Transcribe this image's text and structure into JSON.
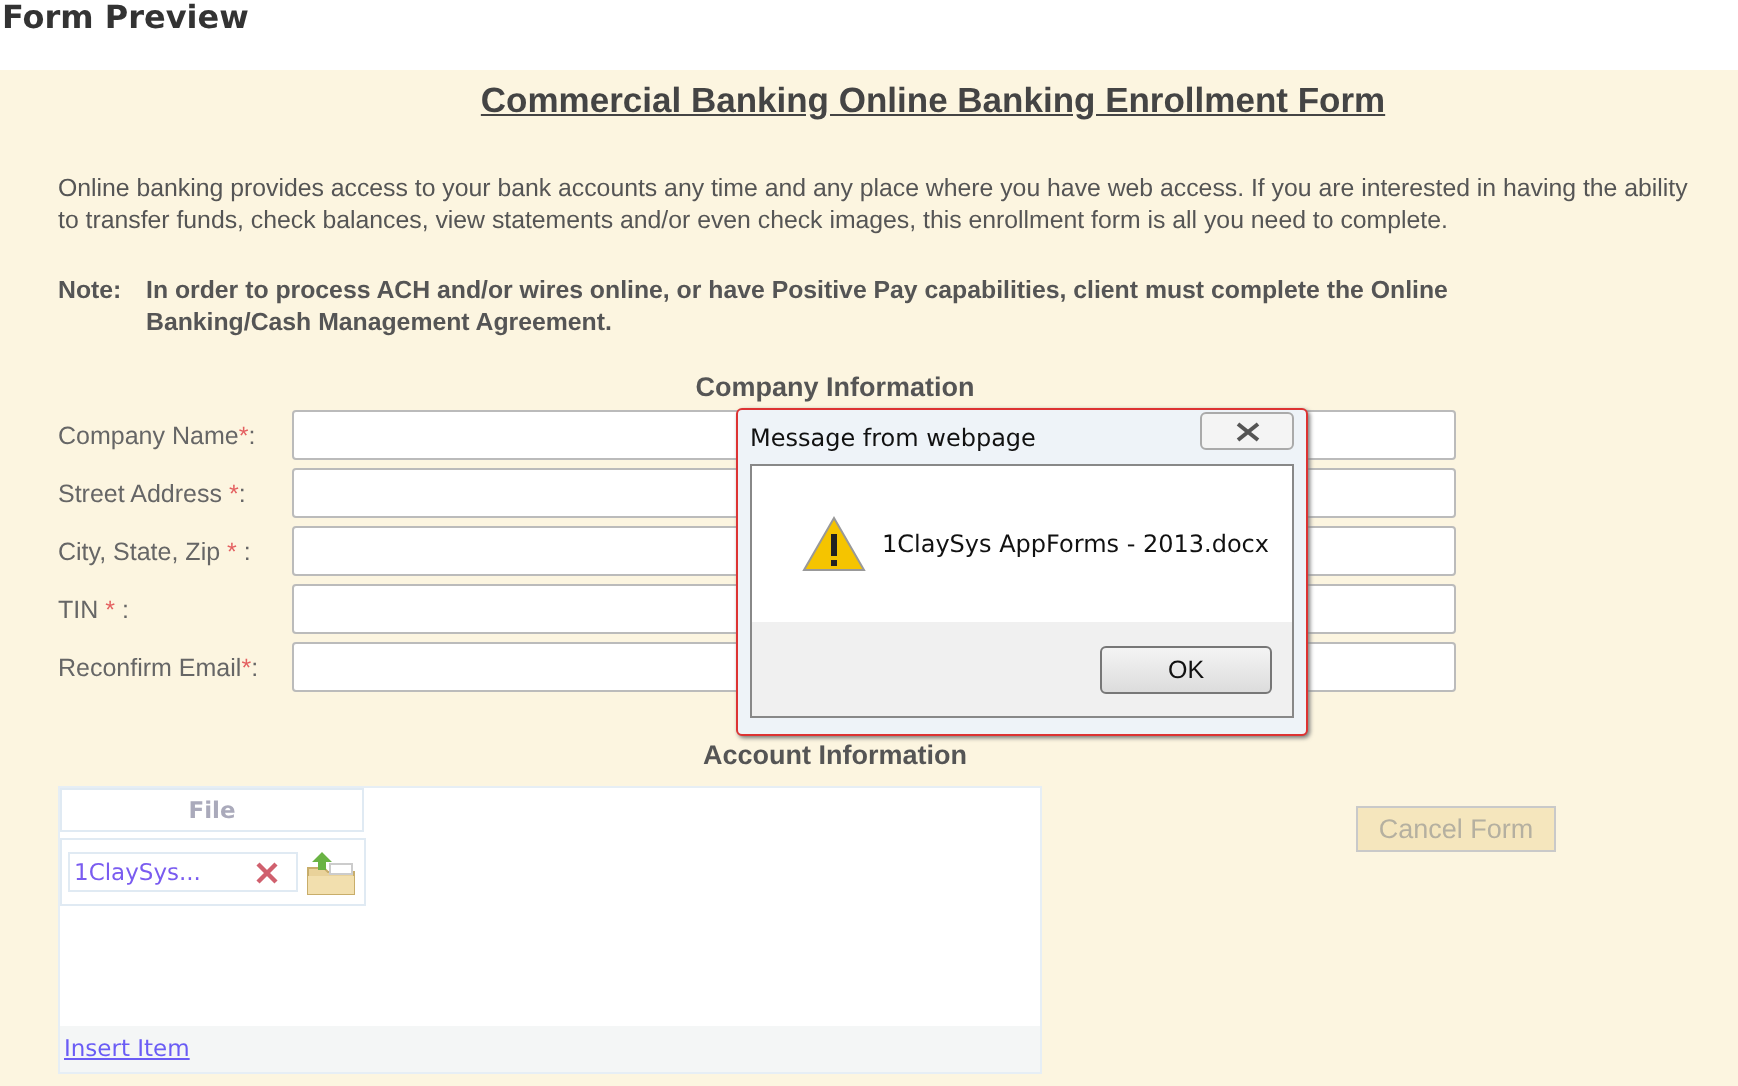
{
  "page_title": "Form Preview",
  "form": {
    "title": "Commercial Banking Online Banking Enrollment Form",
    "intro_lines": [
      "Online banking provides access to your bank accounts any time and any place where you have web access. If you are interested in having the ability",
      "to transfer funds, check balances, view statements and/or even check images, this enrollment form is all you need to complete."
    ],
    "note": {
      "label": "Note:",
      "text": "In order to process ACH and/or wires online, or have Positive Pay capabilities, client must complete the Online Banking/Cash Management Agreement."
    },
    "company_heading": "Company Information",
    "fields": [
      {
        "label": "Company Name",
        "mark": "*",
        "suffix": ":"
      },
      {
        "label": "Street Address ",
        "mark": "*",
        "suffix": ":"
      },
      {
        "label": "City, State, Zip ",
        "mark": "*",
        "suffix": " :"
      },
      {
        "label": "TIN ",
        "mark": "*",
        "suffix": " :"
      },
      {
        "label": "Reconfirm Email",
        "mark": "*",
        "suffix": ":"
      }
    ],
    "account_heading": "Account Information",
    "file_grid": {
      "column": "File",
      "file_name": "1ClaySys...",
      "insert_link": "Insert Item"
    },
    "cancel_button": {
      "label": "Cancel Form",
      "disabled": true
    }
  },
  "dialog": {
    "title": "Message from webpage",
    "message": "1ClaySys AppForms - 2013.docx",
    "button": "OK"
  }
}
